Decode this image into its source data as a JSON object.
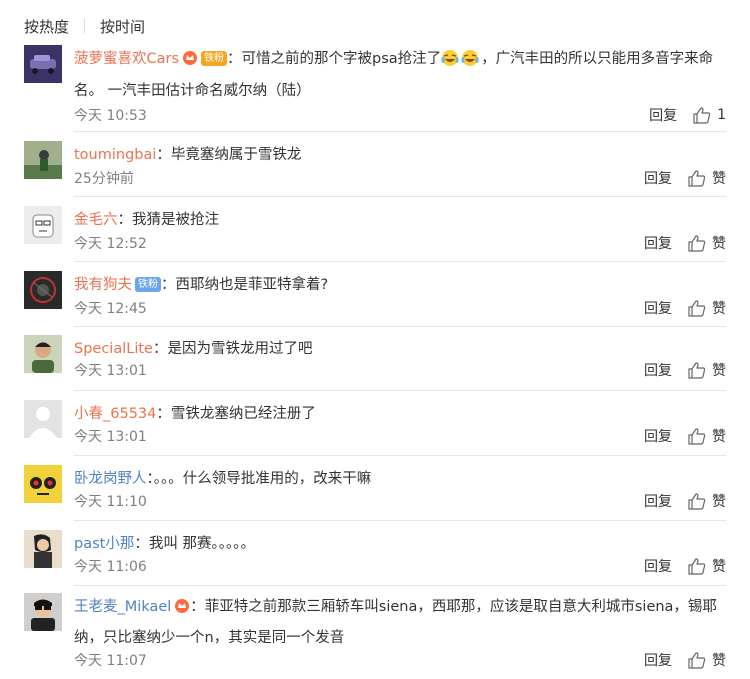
{
  "sort": {
    "hot": "按热度",
    "time": "按时间"
  },
  "reply_label": "回复",
  "like_label": "赞",
  "comments": [
    {
      "user": "菠萝蜜喜欢Cars",
      "pill": "铁粉",
      "text_a": "可惜之前的那个字被psa抢注了",
      "text_b": "，广汽丰田的所以只能用多音字来命名。 一汽丰田估计命名威尔纳（陆）",
      "time": "今天 10:53",
      "likes": "1"
    },
    {
      "user": "toumingbai",
      "text": "毕竟塞纳属于雪铁龙",
      "time": "25分钟前"
    },
    {
      "user": "金毛六",
      "text": "我猜是被抢注",
      "time": "今天 12:52"
    },
    {
      "user": "我有狗夫",
      "pill": "铁粉",
      "text": "西耶纳也是菲亚特拿着?",
      "time": "今天 12:45"
    },
    {
      "user": "SpecialLite",
      "text": "是因为雪铁龙用过了吧",
      "time": "今天 13:01"
    },
    {
      "user": "小春_65534",
      "text": "雪铁龙塞纳已经注册了",
      "time": "今天 13:01"
    },
    {
      "user": "卧龙岗野人",
      "text": "。。。什么领导批准用的，改来干嘛",
      "time": "今天 11:10"
    },
    {
      "user": "past小那",
      "text": "我叫 那赛。。。。。",
      "time": "今天 11:06"
    },
    {
      "user": "王老麦_Mikael",
      "text": "菲亚特之前那款三厢轿车叫siena，西耶那，应该是取自意大利城市siena，锡耶纳，只比塞纳少一个n，其实是同一个发音",
      "time": "今天 11:07"
    }
  ]
}
